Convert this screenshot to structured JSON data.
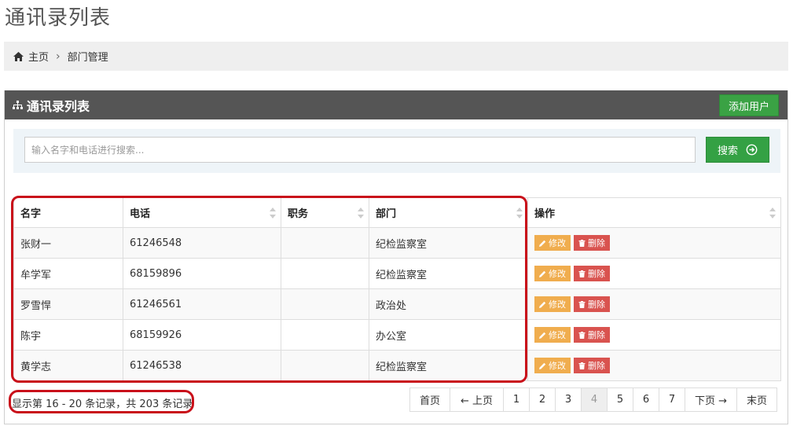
{
  "page": {
    "title": "通讯录列表"
  },
  "breadcrumb": {
    "home": "主页",
    "separator": "›",
    "current": "部门管理"
  },
  "panel": {
    "title": "通讯录列表",
    "add_user_label": "添加用户"
  },
  "search": {
    "placeholder": "输入名字和电话进行搜索...",
    "button_label": "搜索"
  },
  "table": {
    "headers": [
      "名字",
      "电话",
      "职务",
      "部门",
      "操作"
    ],
    "rows": [
      {
        "name": "张财一",
        "phone": "61246548",
        "title": "",
        "dept": "纪检监察室"
      },
      {
        "name": "牟学军",
        "phone": "68159896",
        "title": "",
        "dept": "纪检监察室"
      },
      {
        "name": "罗雪悍",
        "phone": "61246561",
        "title": "",
        "dept": "政治处"
      },
      {
        "name": "陈宇",
        "phone": "68159926",
        "title": "",
        "dept": "办公室"
      },
      {
        "name": "黄学志",
        "phone": "61246538",
        "title": "",
        "dept": "纪检监察室"
      }
    ],
    "edit_label": "修改",
    "delete_label": "删除"
  },
  "info": {
    "text": "显示第 16 - 20 条记录，共 203 条记录"
  },
  "pagination": {
    "first": "首页",
    "prev": "← 上页",
    "pages": [
      "1",
      "2",
      "3",
      "4",
      "5",
      "6",
      "7"
    ],
    "current": "4",
    "next": "下页 →",
    "last": "末页"
  },
  "colors": {
    "header_bg": "#555555",
    "success": "#3aa244",
    "warning": "#f0ad4e",
    "danger": "#d9534f",
    "highlight": "#c9101a"
  }
}
